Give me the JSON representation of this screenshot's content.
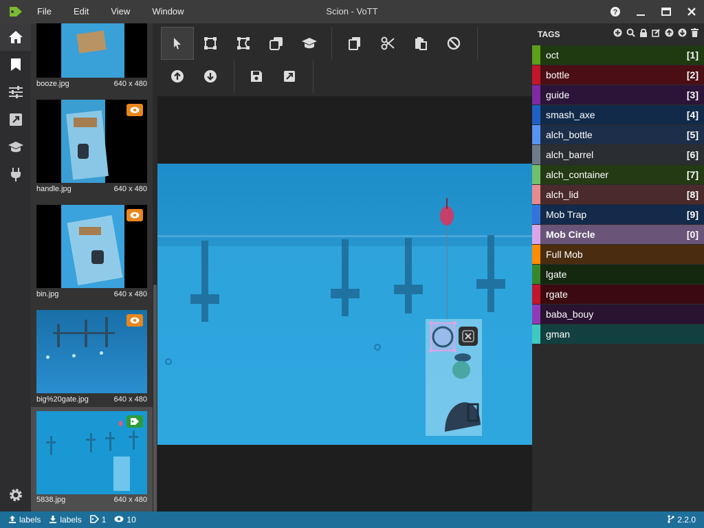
{
  "app": {
    "title": "Scion - VoTT",
    "menu": [
      "File",
      "Edit",
      "View",
      "Window"
    ],
    "accent": "#7cba2f"
  },
  "nav_icons": [
    "home-icon",
    "bookmark-icon",
    "sliders-icon",
    "export-icon",
    "graduation-cap-icon",
    "plug-icon"
  ],
  "thumbnails": [
    {
      "name": "booze.jpg",
      "size": "640 x 480",
      "badge": null
    },
    {
      "name": "handle.jpg",
      "size": "640 x 480",
      "badge": "visited"
    },
    {
      "name": "bin.jpg",
      "size": "640 x 480",
      "badge": "visited"
    },
    {
      "name": "big%20gate.jpg",
      "size": "640 x 480",
      "badge": "visited"
    },
    {
      "name": "5838.jpg",
      "size": "640 x 480",
      "badge": "tagged"
    }
  ],
  "tags": {
    "title": "TAGS",
    "items": [
      {
        "label": "oct",
        "key": "[1]",
        "color": "#5d9f1b",
        "bg": "#1f3a10"
      },
      {
        "label": "bottle",
        "key": "[2]",
        "color": "#c4162a",
        "bg": "#4a0e14"
      },
      {
        "label": "guide",
        "key": "[3]",
        "color": "#7e2aa5",
        "bg": "#2c1438"
      },
      {
        "label": "smash_axe",
        "key": "[4]",
        "color": "#1f60c4",
        "bg": "#122a4a"
      },
      {
        "label": "alch_bottle",
        "key": "[5]",
        "color": "#5794f2",
        "bg": "#1d2e4a"
      },
      {
        "label": "alch_barrel",
        "key": "[6]",
        "color": "#6e7b8b",
        "bg": "#2a2d31"
      },
      {
        "label": "alch_container",
        "key": "[7]",
        "color": "#73bf69",
        "bg": "#233a14"
      },
      {
        "label": "alch_lid",
        "key": "[8]",
        "color": "#e88b8f",
        "bg": "#4a2a2b"
      },
      {
        "label": "Mob Trap",
        "key": "[9]",
        "color": "#3274d9",
        "bg": "#132a4a"
      },
      {
        "label": "Mob Circle",
        "key": "[0]",
        "color": "#d8a6e8",
        "bg": "#6a5478",
        "selected": true
      },
      {
        "label": "Full Mob",
        "key": "",
        "color": "#ff8c00",
        "bg": "#4a2c10"
      },
      {
        "label": "lgate",
        "key": "",
        "color": "#37872d",
        "bg": "#14270f"
      },
      {
        "label": "rgate",
        "key": "",
        "color": "#c4162a",
        "bg": "#3a0a10"
      },
      {
        "label": "baba_bouy",
        "key": "",
        "color": "#8f3bb8",
        "bg": "#2a1231"
      },
      {
        "label": "gman",
        "key": "",
        "color": "#3fc8c0",
        "bg": "#124040"
      }
    ]
  },
  "statusbar": {
    "source": "labels",
    "target": "labels",
    "tagged_count": "1",
    "visited_count": "10",
    "version": "2.2.0",
    "color": "#1d6f9a"
  }
}
